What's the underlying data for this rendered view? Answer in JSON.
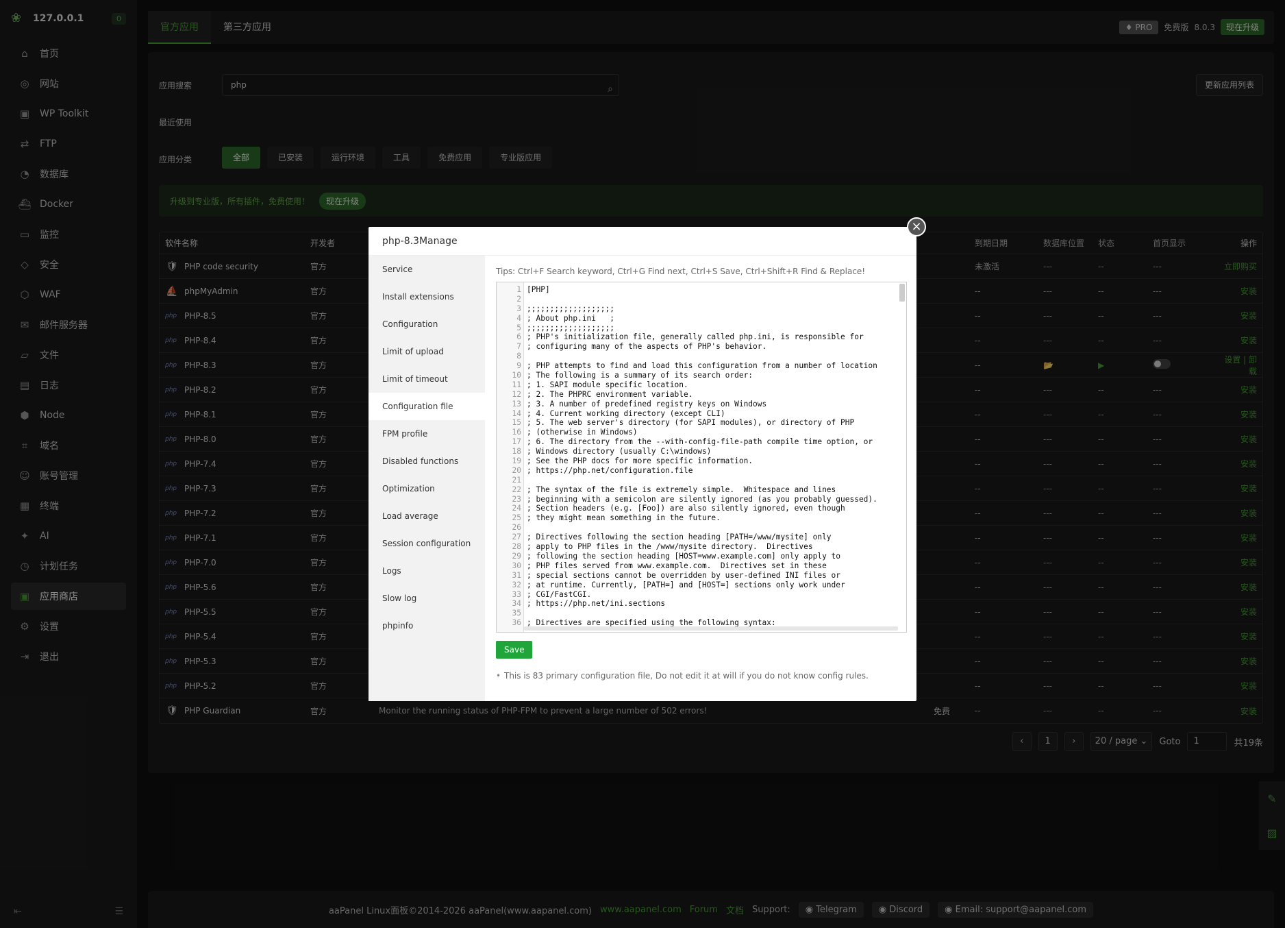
{
  "sidebar": {
    "host": "127.0.0.1",
    "badge": "0",
    "items": [
      {
        "label": "首页",
        "icon": "home-icon",
        "glyph": "⌂"
      },
      {
        "label": "网站",
        "icon": "globe-icon",
        "glyph": "◎"
      },
      {
        "label": "WP Toolkit",
        "icon": "wordpress-icon",
        "glyph": "▣"
      },
      {
        "label": "FTP",
        "icon": "transfer-icon",
        "glyph": "⇄"
      },
      {
        "label": "数据库",
        "icon": "database-icon",
        "glyph": "◔"
      },
      {
        "label": "Docker",
        "icon": "docker-icon",
        "glyph": "⛴"
      },
      {
        "label": "监控",
        "icon": "monitor-icon",
        "glyph": "▭"
      },
      {
        "label": "安全",
        "icon": "shield-icon",
        "glyph": "◇"
      },
      {
        "label": "WAF",
        "icon": "firewall-icon",
        "glyph": "⬡"
      },
      {
        "label": "邮件服务器",
        "icon": "mail-icon",
        "glyph": "✉"
      },
      {
        "label": "文件",
        "icon": "folder-icon",
        "glyph": "▱"
      },
      {
        "label": "日志",
        "icon": "log-icon",
        "glyph": "▤"
      },
      {
        "label": "Node",
        "icon": "node-icon",
        "glyph": "⬢"
      },
      {
        "label": "域名",
        "icon": "domain-icon",
        "glyph": "⌗"
      },
      {
        "label": "账号管理",
        "icon": "user-icon",
        "glyph": "☺"
      },
      {
        "label": "终端",
        "icon": "terminal-icon",
        "glyph": "▦"
      },
      {
        "label": "AI",
        "icon": "ai-icon",
        "glyph": "✦"
      },
      {
        "label": "计划任务",
        "icon": "clock-icon",
        "glyph": "◷"
      },
      {
        "label": "应用商店",
        "icon": "store-icon",
        "glyph": "▣"
      },
      {
        "label": "设置",
        "icon": "gear-icon",
        "glyph": "⚙"
      },
      {
        "label": "退出",
        "icon": "logout-icon",
        "glyph": "⇥"
      }
    ],
    "active_index": 18
  },
  "topbar": {
    "tabs": [
      "官方应用",
      "第三方应用"
    ],
    "pro": "PRO",
    "edition": "免费版",
    "version": "8.0.3",
    "upgrade": "现在升级"
  },
  "main": {
    "search_label": "应用搜索",
    "search_value": "php",
    "refresh_button": "更新应用列表",
    "recent_label": "最近使用",
    "category_label": "应用分类",
    "categories": [
      "全部",
      "已安装",
      "运行环境",
      "工具",
      "免费应用",
      "专业版应用"
    ],
    "banner_text": "升级到专业版，所有插件，免费使用！",
    "banner_button": "现在升级"
  },
  "table": {
    "headers": {
      "name": "软件名称",
      "dev": "开发者",
      "expire": "到期日期",
      "location": "数据库位置",
      "status": "状态",
      "home": "首页显示",
      "ops": "操作"
    },
    "rows": [
      {
        "name": "PHP code security",
        "icon": "🛡",
        "dev": "官方",
        "desc": "",
        "price": "",
        "expire": "未激活",
        "loc": "---",
        "st": "--",
        "home": "---",
        "op": "立即购买"
      },
      {
        "name": "phpMyAdmin",
        "icon": "⛵",
        "dev": "官方",
        "desc": "",
        "price": "",
        "expire": "--",
        "loc": "---",
        "st": "--",
        "home": "---",
        "op": "安装"
      },
      {
        "name": "PHP-8.5",
        "icon": "php",
        "dev": "官方",
        "desc": "",
        "price": "",
        "expire": "--",
        "loc": "---",
        "st": "--",
        "home": "---",
        "op": "安装"
      },
      {
        "name": "PHP-8.4",
        "icon": "php",
        "dev": "官方",
        "desc": "",
        "price": "",
        "expire": "--",
        "loc": "---",
        "st": "--",
        "home": "---",
        "op": "安装"
      },
      {
        "name": "PHP-8.3",
        "icon": "php",
        "dev": "官方",
        "desc": "",
        "price": "",
        "expire": "--",
        "loc": "📂",
        "st": "▶",
        "home": "toggle",
        "op": "设置 | 卸载"
      },
      {
        "name": "PHP-8.2",
        "icon": "php",
        "dev": "官方",
        "desc": "",
        "price": "",
        "expire": "--",
        "loc": "---",
        "st": "--",
        "home": "---",
        "op": "安装"
      },
      {
        "name": "PHP-8.1",
        "icon": "php",
        "dev": "官方",
        "desc": "",
        "price": "",
        "expire": "--",
        "loc": "---",
        "st": "--",
        "home": "---",
        "op": "安装"
      },
      {
        "name": "PHP-8.0",
        "icon": "php",
        "dev": "官方",
        "desc": "",
        "price": "",
        "expire": "--",
        "loc": "---",
        "st": "--",
        "home": "---",
        "op": "安装"
      },
      {
        "name": "PHP-7.4",
        "icon": "php",
        "dev": "官方",
        "desc": "",
        "price": "",
        "expire": "--",
        "loc": "---",
        "st": "--",
        "home": "---",
        "op": "安装"
      },
      {
        "name": "PHP-7.3",
        "icon": "php",
        "dev": "官方",
        "desc": "",
        "price": "",
        "expire": "--",
        "loc": "---",
        "st": "--",
        "home": "---",
        "op": "安装"
      },
      {
        "name": "PHP-7.2",
        "icon": "php",
        "dev": "官方",
        "desc": "",
        "price": "",
        "expire": "--",
        "loc": "---",
        "st": "--",
        "home": "---",
        "op": "安装"
      },
      {
        "name": "PHP-7.1",
        "icon": "php",
        "dev": "官方",
        "desc": "",
        "price": "",
        "expire": "--",
        "loc": "---",
        "st": "--",
        "home": "---",
        "op": "安装"
      },
      {
        "name": "PHP-7.0",
        "icon": "php",
        "dev": "官方",
        "desc": "",
        "price": "",
        "expire": "--",
        "loc": "---",
        "st": "--",
        "home": "---",
        "op": "安装"
      },
      {
        "name": "PHP-5.6",
        "icon": "php",
        "dev": "官方",
        "desc": "",
        "price": "",
        "expire": "--",
        "loc": "---",
        "st": "--",
        "home": "---",
        "op": "安装"
      },
      {
        "name": "PHP-5.5",
        "icon": "php",
        "dev": "官方",
        "desc": "",
        "price": "",
        "expire": "--",
        "loc": "---",
        "st": "--",
        "home": "---",
        "op": "安装"
      },
      {
        "name": "PHP-5.4",
        "icon": "php",
        "dev": "官方",
        "desc": "",
        "price": "",
        "expire": "--",
        "loc": "---",
        "st": "--",
        "home": "---",
        "op": "安装"
      },
      {
        "name": "PHP-5.3",
        "icon": "php",
        "dev": "官方",
        "desc": "",
        "price": "",
        "expire": "--",
        "loc": "---",
        "st": "--",
        "home": "---",
        "op": "安装"
      },
      {
        "name": "PHP-5.2",
        "icon": "php",
        "dev": "官方",
        "desc": "",
        "price": "",
        "expire": "--",
        "loc": "---",
        "st": "--",
        "home": "---",
        "op": "安装"
      },
      {
        "name": "PHP Guardian",
        "icon": "🛡",
        "dev": "官方",
        "desc": "Monitor the running status of PHP-FPM to prevent a large number of 502 errors!",
        "price": "免费",
        "expire": "--",
        "loc": "---",
        "st": "--",
        "home": "---",
        "op": "安装"
      }
    ]
  },
  "pager": {
    "page": "1",
    "per_page": "20 / page",
    "goto_label": "Goto",
    "goto_value": "1",
    "total": "共19条"
  },
  "footer": {
    "copyright": "aaPanel Linux面板©2014-2026 aaPanel(www.aapanel.com)",
    "site": "www.aapanel.com",
    "forum": "Forum",
    "docs": "文档",
    "support_label": "Support:",
    "telegram": "Telegram",
    "discord": "Discord",
    "email": "Email: support@aapanel.com"
  },
  "modal": {
    "title": "php-8.3Manage",
    "nav": [
      "Service",
      "Install extensions",
      "Configuration",
      "Limit of upload",
      "Limit of timeout",
      "Configuration file",
      "FPM profile",
      "Disabled functions",
      "Optimization",
      "Load average",
      "Session configuration",
      "Logs",
      "Slow log",
      "phpinfo"
    ],
    "active_nav": 5,
    "tips": "Tips:  Ctrl+F Search keyword,  Ctrl+G Find next,  Ctrl+S Save,  Ctrl+Shift+R Find & Replace!",
    "save": "Save",
    "note": "This is 83 primary configuration file, Do not edit it at will if you do not know config rules.",
    "code_lines": [
      "[PHP]",
      "",
      ";;;;;;;;;;;;;;;;;;;",
      "; About php.ini   ;",
      ";;;;;;;;;;;;;;;;;;;",
      "; PHP's initialization file, generally called php.ini, is responsible for",
      "; configuring many of the aspects of PHP's behavior.",
      "",
      "; PHP attempts to find and load this configuration from a number of location",
      "; The following is a summary of its search order:",
      "; 1. SAPI module specific location.",
      "; 2. The PHPRC environment variable.",
      "; 3. A number of predefined registry keys on Windows",
      "; 4. Current working directory (except CLI)",
      "; 5. The web server's directory (for SAPI modules), or directory of PHP",
      "; (otherwise in Windows)",
      "; 6. The directory from the --with-config-file-path compile time option, or",
      "; Windows directory (usually C:\\windows)",
      "; See the PHP docs for more specific information.",
      "; https://php.net/configuration.file",
      "",
      "; The syntax of the file is extremely simple.  Whitespace and lines",
      "; beginning with a semicolon are silently ignored (as you probably guessed).",
      "; Section headers (e.g. [Foo]) are also silently ignored, even though",
      "; they might mean something in the future.",
      "",
      "; Directives following the section heading [PATH=/www/mysite] only",
      "; apply to PHP files in the /www/mysite directory.  Directives",
      "; following the section heading [HOST=www.example.com] only apply to",
      "; PHP files served from www.example.com.  Directives set in these",
      "; special sections cannot be overridden by user-defined INI files or",
      "; at runtime. Currently, [PATH=] and [HOST=] sections only work under",
      "; CGI/FastCGI.",
      "; https://php.net/ini.sections",
      "",
      "; Directives are specified using the following syntax:"
    ]
  }
}
